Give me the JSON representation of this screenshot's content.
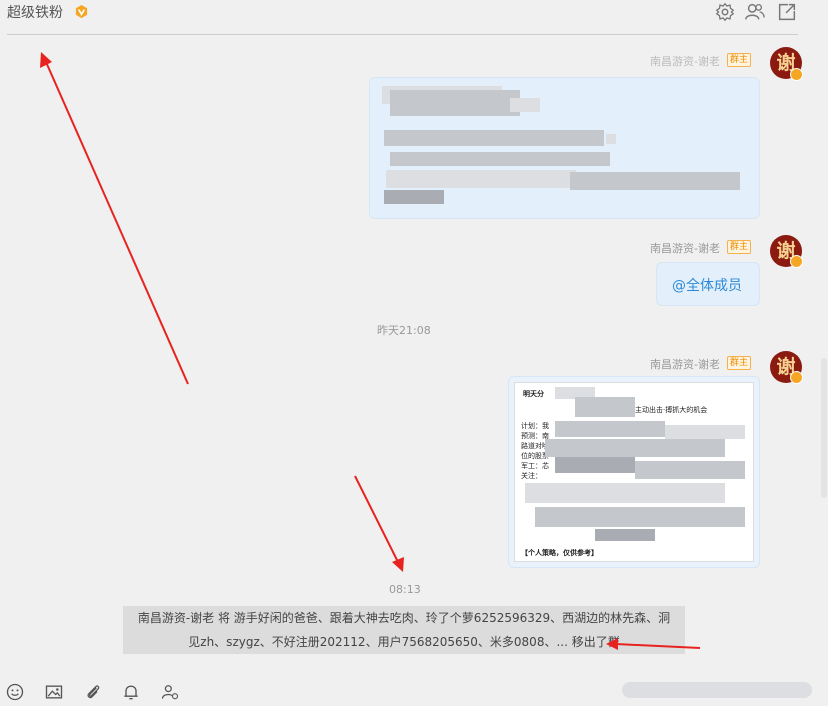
{
  "header": {
    "title": "超级铁粉",
    "icons": [
      "settings-icon",
      "members-icon",
      "share-icon"
    ]
  },
  "messages": [
    {
      "sender": "南昌游资-谢老",
      "role": "群主",
      "avatar_char": "谢",
      "content_type": "blurred-text"
    },
    {
      "sender": "南昌游资-谢老",
      "role": "群主",
      "avatar_char": "谢",
      "content": "@全体成员"
    },
    {
      "time": "昨天21:08"
    },
    {
      "sender": "南昌游资-谢老",
      "role": "群主",
      "avatar_char": "谢",
      "content_type": "image",
      "image_lines": {
        "top": "明天分",
        "mid": "主动出击·搏抓大的机会",
        "l1": "计划：我",
        "l2": "预测：南",
        "l3": "路道对哟",
        "l4": "位的股票",
        "l5": "军工：芯",
        "l6": "关注：",
        "bottom": "【个人策略，仅供参考】"
      }
    }
  ],
  "notice": {
    "time": "08:13",
    "line1": "南昌游资-谢老 将 游手好闲的爸爸、跟着大神去吃肉、玲了个萝6252596329、西湖边的林先森、洞",
    "line2": "见zh、szygz、不好注册202112、用户7568205650、米多0808、... 移出了群"
  },
  "toolbar": {
    "icons": [
      "emoji-icon",
      "image-icon",
      "attachment-icon",
      "bell-icon",
      "mention-icon"
    ]
  },
  "colors": {
    "accent": "#2e8ad8",
    "annotation": "#e8231f",
    "badge": "#f08c00"
  }
}
